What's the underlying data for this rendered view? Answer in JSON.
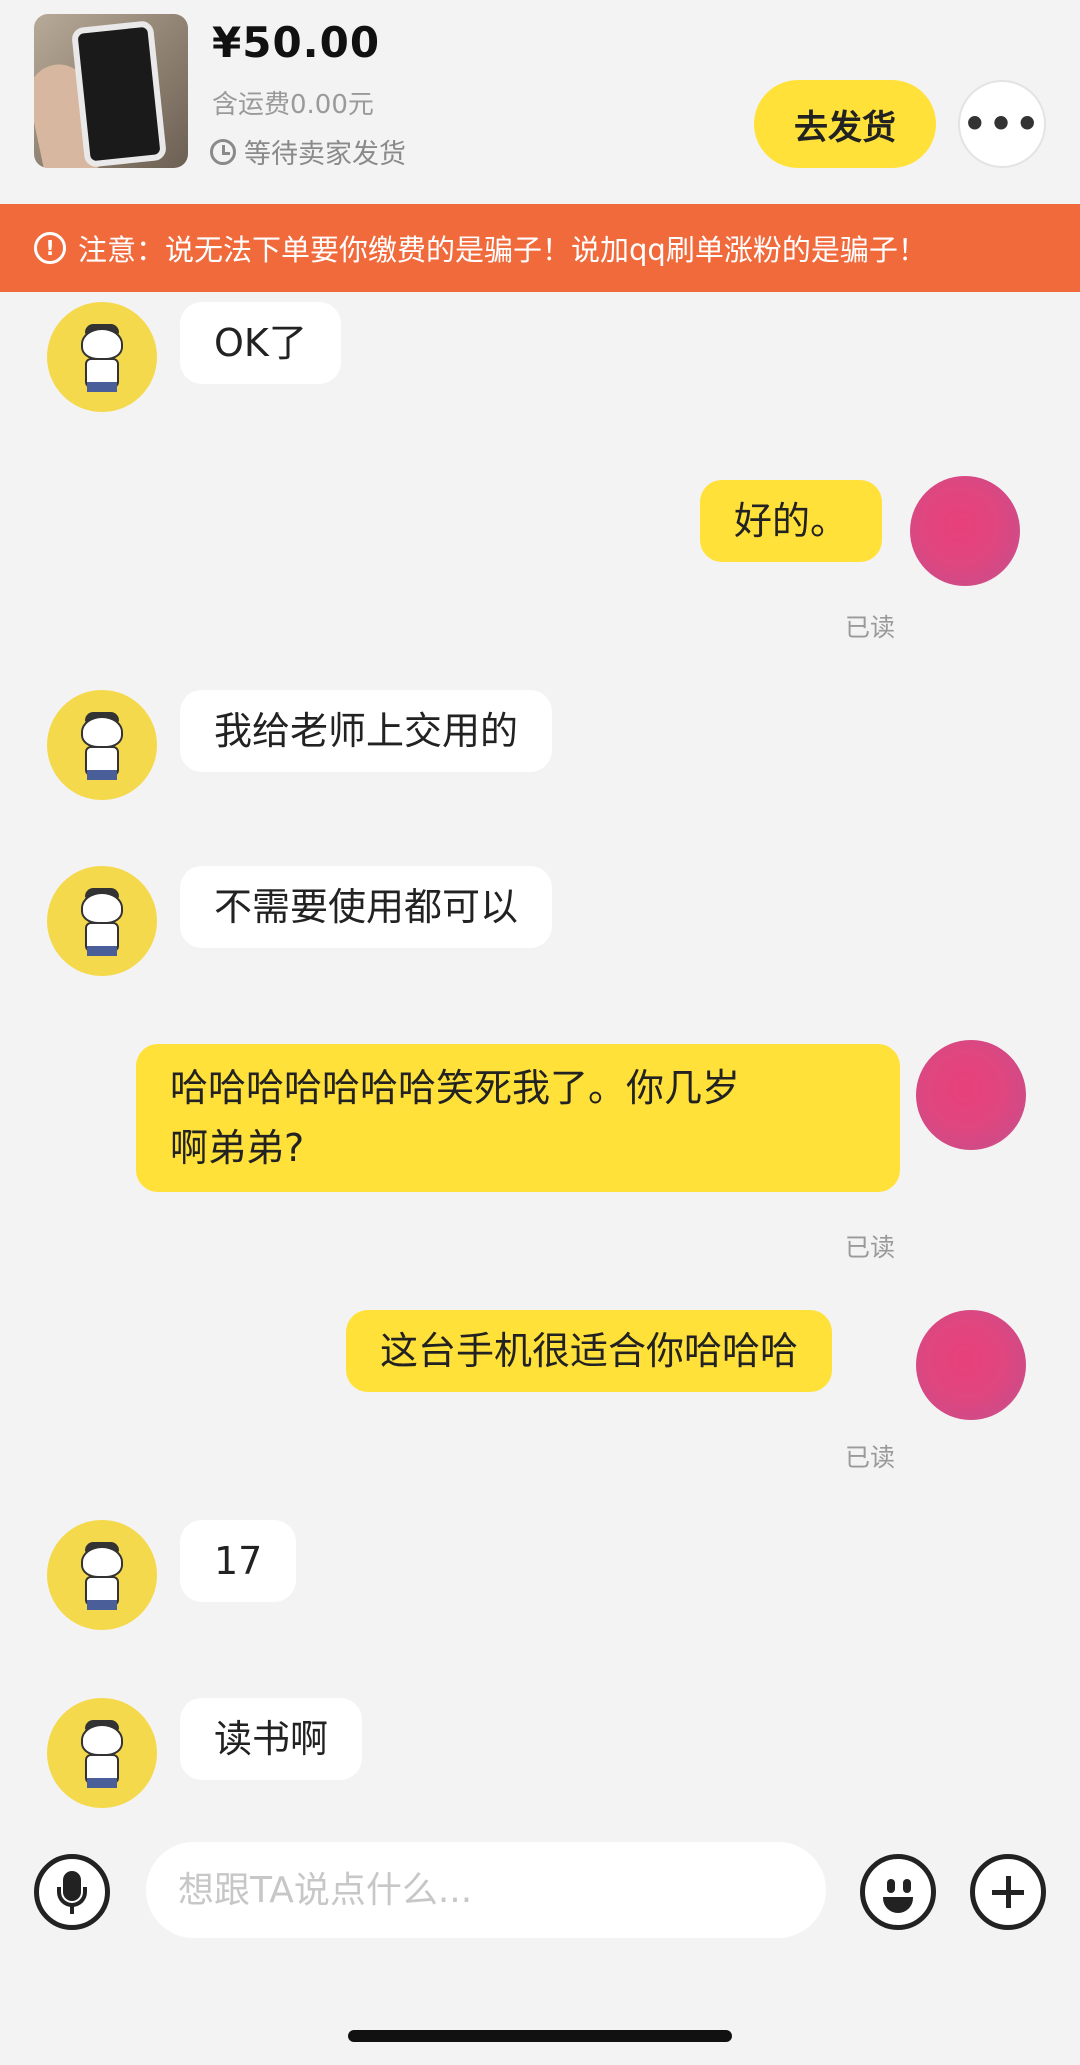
{
  "order": {
    "price": "¥50.00",
    "shipping": "含运费0.00元",
    "status": "等待卖家发货",
    "ship_button": "去发货",
    "more_button": "•••"
  },
  "warning": {
    "icon_glyph": "!",
    "text": "注意：说无法下单要你缴费的是骗子！说加qq刷单涨粉的是骗子！"
  },
  "messages": [
    {
      "side": "left",
      "text": "OK了"
    },
    {
      "side": "right",
      "text": "好的。",
      "read": "已读"
    },
    {
      "side": "left",
      "text": "我给老师上交用的"
    },
    {
      "side": "left",
      "text": "不需要使用都可以"
    },
    {
      "side": "right",
      "lines": [
        "哈哈哈哈哈哈哈笑死我了。你几岁",
        "啊弟弟?"
      ],
      "read": "已读"
    },
    {
      "side": "right",
      "text": "这台手机很适合你哈哈哈",
      "read": "已读"
    },
    {
      "side": "left",
      "text": "17"
    },
    {
      "side": "left",
      "text": "读书啊"
    }
  ],
  "input": {
    "placeholder": "想跟TA说点什么..."
  },
  "icons": {
    "clock": "clock-icon",
    "warning": "warning-icon",
    "mic": "microphone-icon",
    "emoji": "emoji-icon",
    "plus": "plus-icon"
  },
  "colors": {
    "accent_yellow": "#ffe13a",
    "warning_orange": "#f06a3c",
    "background": "#f3f3f3"
  }
}
